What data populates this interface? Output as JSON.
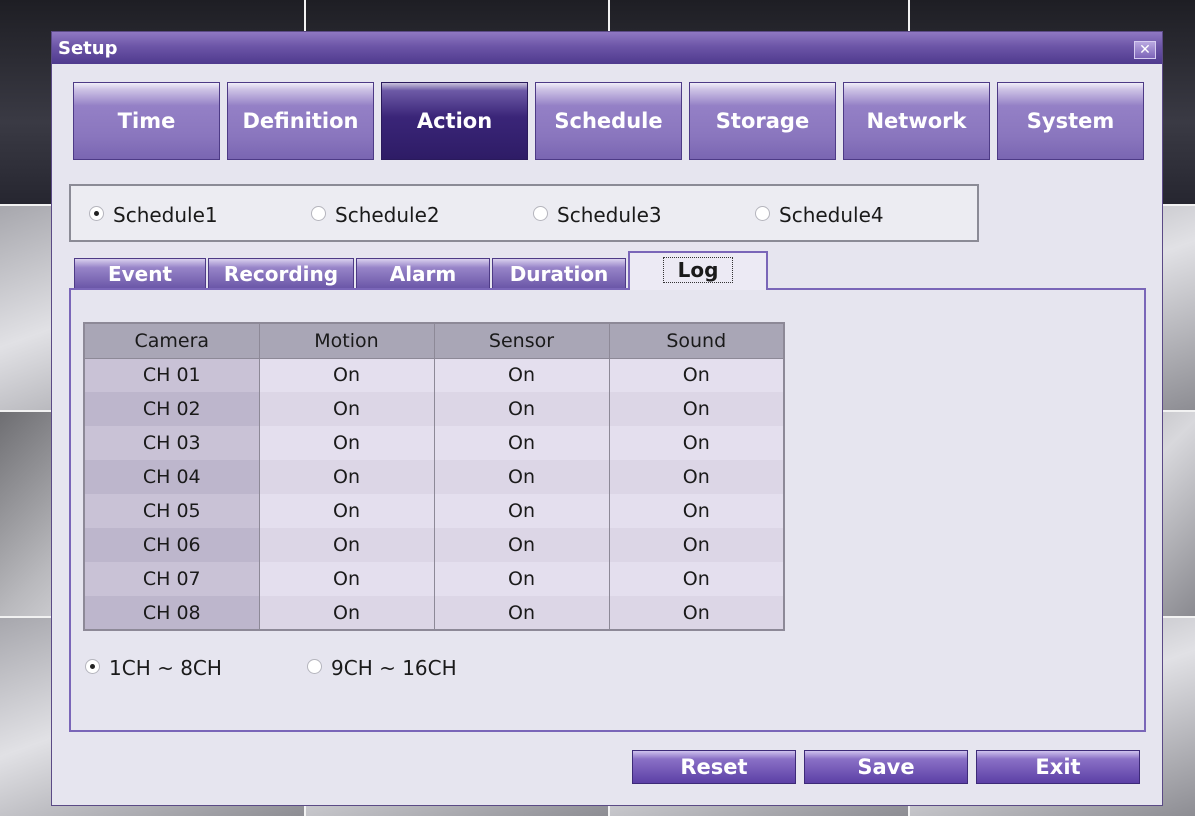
{
  "window": {
    "title": "Setup"
  },
  "main_tabs": [
    {
      "label": "Time",
      "active": false
    },
    {
      "label": "Definition",
      "active": false
    },
    {
      "label": "Action",
      "active": true
    },
    {
      "label": "Schedule",
      "active": false
    },
    {
      "label": "Storage",
      "active": false
    },
    {
      "label": "Network",
      "active": false
    },
    {
      "label": "System",
      "active": false
    }
  ],
  "schedules": [
    {
      "label": "Schedule1",
      "selected": true
    },
    {
      "label": "Schedule2",
      "selected": false
    },
    {
      "label": "Schedule3",
      "selected": false
    },
    {
      "label": "Schedule4",
      "selected": false
    }
  ],
  "sub_tabs": [
    {
      "label": "Event",
      "active": false
    },
    {
      "label": "Recording",
      "active": false
    },
    {
      "label": "Alarm",
      "active": false
    },
    {
      "label": "Duration",
      "active": false
    },
    {
      "label": "Log",
      "active": true
    }
  ],
  "log_table": {
    "headers": [
      "Camera",
      "Motion",
      "Sensor",
      "Sound"
    ],
    "rows": [
      [
        "CH 01",
        "On",
        "On",
        "On"
      ],
      [
        "CH 02",
        "On",
        "On",
        "On"
      ],
      [
        "CH 03",
        "On",
        "On",
        "On"
      ],
      [
        "CH 04",
        "On",
        "On",
        "On"
      ],
      [
        "CH 05",
        "On",
        "On",
        "On"
      ],
      [
        "CH 06",
        "On",
        "On",
        "On"
      ],
      [
        "CH 07",
        "On",
        "On",
        "On"
      ],
      [
        "CH 08",
        "On",
        "On",
        "On"
      ]
    ]
  },
  "channel_ranges": [
    {
      "label": "1CH ~ 8CH",
      "selected": true
    },
    {
      "label": "9CH ~ 16CH",
      "selected": false
    }
  ],
  "buttons": {
    "reset": "Reset",
    "save": "Save",
    "exit": "Exit"
  },
  "icons": {
    "close": "close-icon",
    "radio": "radio-icon"
  },
  "colors": {
    "accent": "#4f3a8e",
    "active_tab": "#2e1c66",
    "panel_border": "#7a66b8"
  }
}
